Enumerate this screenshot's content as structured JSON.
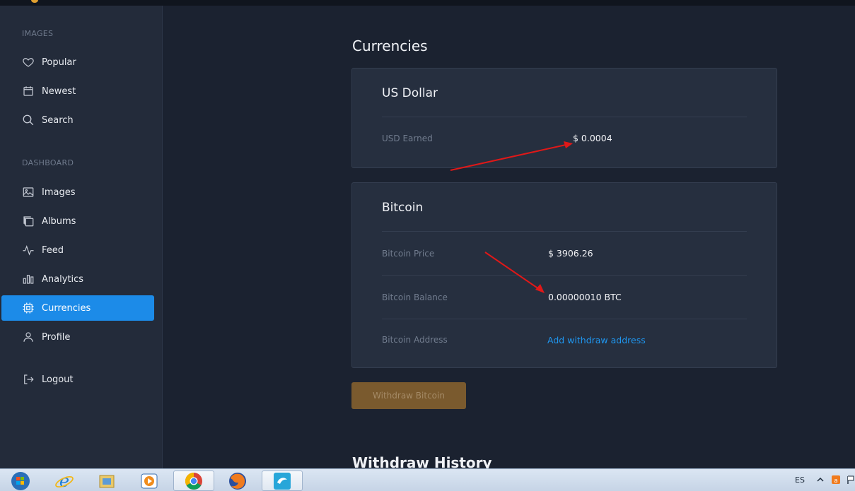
{
  "sidebar": {
    "sections": [
      {
        "label": "IMAGES"
      },
      {
        "label": "DASHBOARD"
      }
    ],
    "items": [
      {
        "label": "Popular",
        "icon": "heart-icon"
      },
      {
        "label": "Newest",
        "icon": "calendar-icon"
      },
      {
        "label": "Search",
        "icon": "search-icon"
      },
      {
        "label": "Images",
        "icon": "image-icon"
      },
      {
        "label": "Albums",
        "icon": "albums-icon"
      },
      {
        "label": "Feed",
        "icon": "activity-icon"
      },
      {
        "label": "Analytics",
        "icon": "bar-chart-icon"
      },
      {
        "label": "Currencies",
        "icon": "chip-icon",
        "active": true
      },
      {
        "label": "Profile",
        "icon": "user-icon"
      },
      {
        "label": "Logout",
        "icon": "logout-icon"
      }
    ]
  },
  "main": {
    "title": "Currencies",
    "usd_card": {
      "title": "US Dollar",
      "rows": [
        {
          "label": "USD Earned",
          "value": "$ 0.0004"
        }
      ]
    },
    "btc_card": {
      "title": "Bitcoin",
      "rows": [
        {
          "label": "Bitcoin Price",
          "value": "$ 3906.26"
        },
        {
          "label": "Bitcoin Balance",
          "value": "0.00000010 BTC"
        },
        {
          "label": "Bitcoin Address",
          "value": "Add withdraw address"
        }
      ]
    },
    "withdraw_button": "Withdraw Bitcoin",
    "history_title": "Withdraw History"
  },
  "taskbar": {
    "language": "ES",
    "apps": [
      "start-orb",
      "internet-explorer",
      "file-explorer",
      "media-player",
      "chrome",
      "firefox",
      "app"
    ]
  },
  "colors": {
    "background": "#1b2230",
    "sidebar": "#232b3a",
    "card": "#262f3f",
    "accent": "#1c8be8",
    "link": "#1f96ef",
    "withdraw_button": "#7a5a2e",
    "annotation_arrow": "#e01818"
  }
}
